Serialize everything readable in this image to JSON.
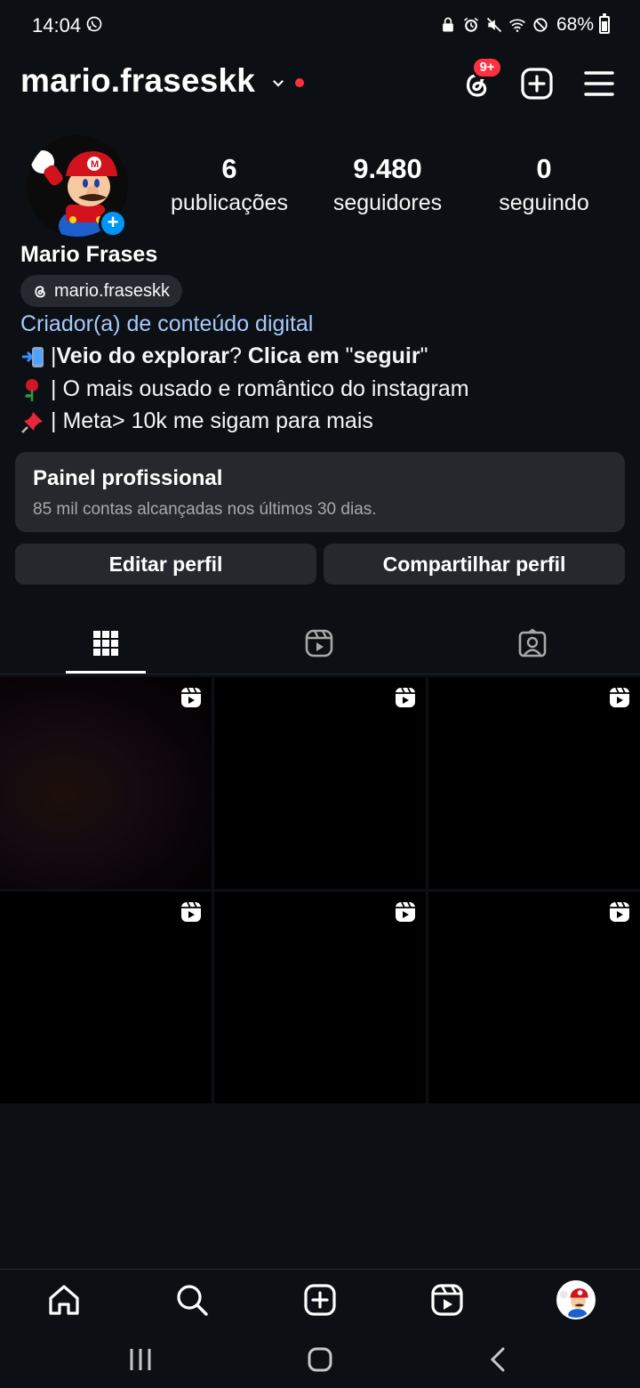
{
  "status_bar": {
    "time": "14:04",
    "battery": "68%"
  },
  "header": {
    "username": "mario.fraseskk",
    "threads_badge": "9+"
  },
  "profile": {
    "stats": {
      "posts_count": "6",
      "posts_label": "publicações",
      "followers_count": "9.480",
      "followers_label": "seguidores",
      "following_count": "0",
      "following_label": "seguindo"
    },
    "full_name": "Mario Frases",
    "threads_handle": "mario.fraseskk",
    "category": "Criador(a) de conteúdo digital",
    "bio": {
      "line1_part1": "| ",
      "line1_bold1": "Veio do explorar",
      "line1_part2": "? ",
      "line1_bold2": "Clica em ",
      "line1_quote_open": "\"",
      "line1_bold3": "seguir",
      "line1_quote_close": "\"",
      "line2": "| O mais ousado e romântico do instagram",
      "line3": "| Meta> 10k me sigam para mais"
    },
    "emojis": [
      "mobile-arrow-emoji",
      "rose-emoji",
      "pushpin-emoji"
    ]
  },
  "dashboard": {
    "title": "Painel profissional",
    "subtitle": "85 mil contas alcançadas nos últimos 30 dias."
  },
  "buttons": {
    "edit": "Editar perfil",
    "share": "Compartilhar perfil"
  },
  "tabs": [
    {
      "name": "posts-grid-tab",
      "icon": "grid-icon",
      "active": true
    },
    {
      "name": "reels-tab",
      "icon": "reels-icon",
      "active": false
    },
    {
      "name": "tagged-tab",
      "icon": "tagged-person-icon",
      "active": false
    }
  ],
  "posts": [
    {
      "type": "reel"
    },
    {
      "type": "reel"
    },
    {
      "type": "reel"
    },
    {
      "type": "reel"
    },
    {
      "type": "reel"
    },
    {
      "type": "reel"
    }
  ],
  "bottom_nav": [
    "home-icon",
    "search-icon",
    "create-icon",
    "reels-icon",
    "profile-avatar"
  ],
  "colors": {
    "background": "#0c1014",
    "surface": "#25292e",
    "link": "#a8c7fa",
    "badge": "#ff3040",
    "accent": "#0095f6"
  }
}
